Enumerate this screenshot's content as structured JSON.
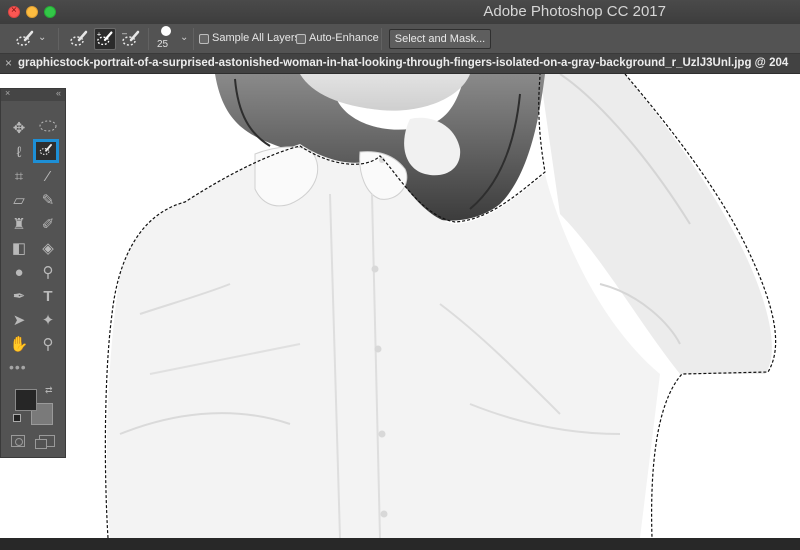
{
  "window": {
    "app_title": "Adobe Photoshop CC 2017"
  },
  "options_bar": {
    "tool_preset_icon": "quick-selection-brush-icon",
    "brush_size": "25",
    "sample_all_layers_label": "Sample All Layers",
    "sample_all_layers_checked": false,
    "auto_enhance_label": "Auto-Enhance",
    "auto_enhance_checked": false,
    "select_mask_label": "Select and Mask..."
  },
  "document": {
    "tab_title": "graphicstock-portrait-of-a-surprised-astonished-woman-in-hat-looking-through-fingers-isolated-on-a-gray-background_r_UzlJ3Unl.jpg @ 204"
  },
  "toolbox": {
    "active_tool": "quick-selection-tool",
    "accent_color": "#1d8fd6",
    "foreground_color": "#262626",
    "background_color": "#7a7a7a"
  }
}
